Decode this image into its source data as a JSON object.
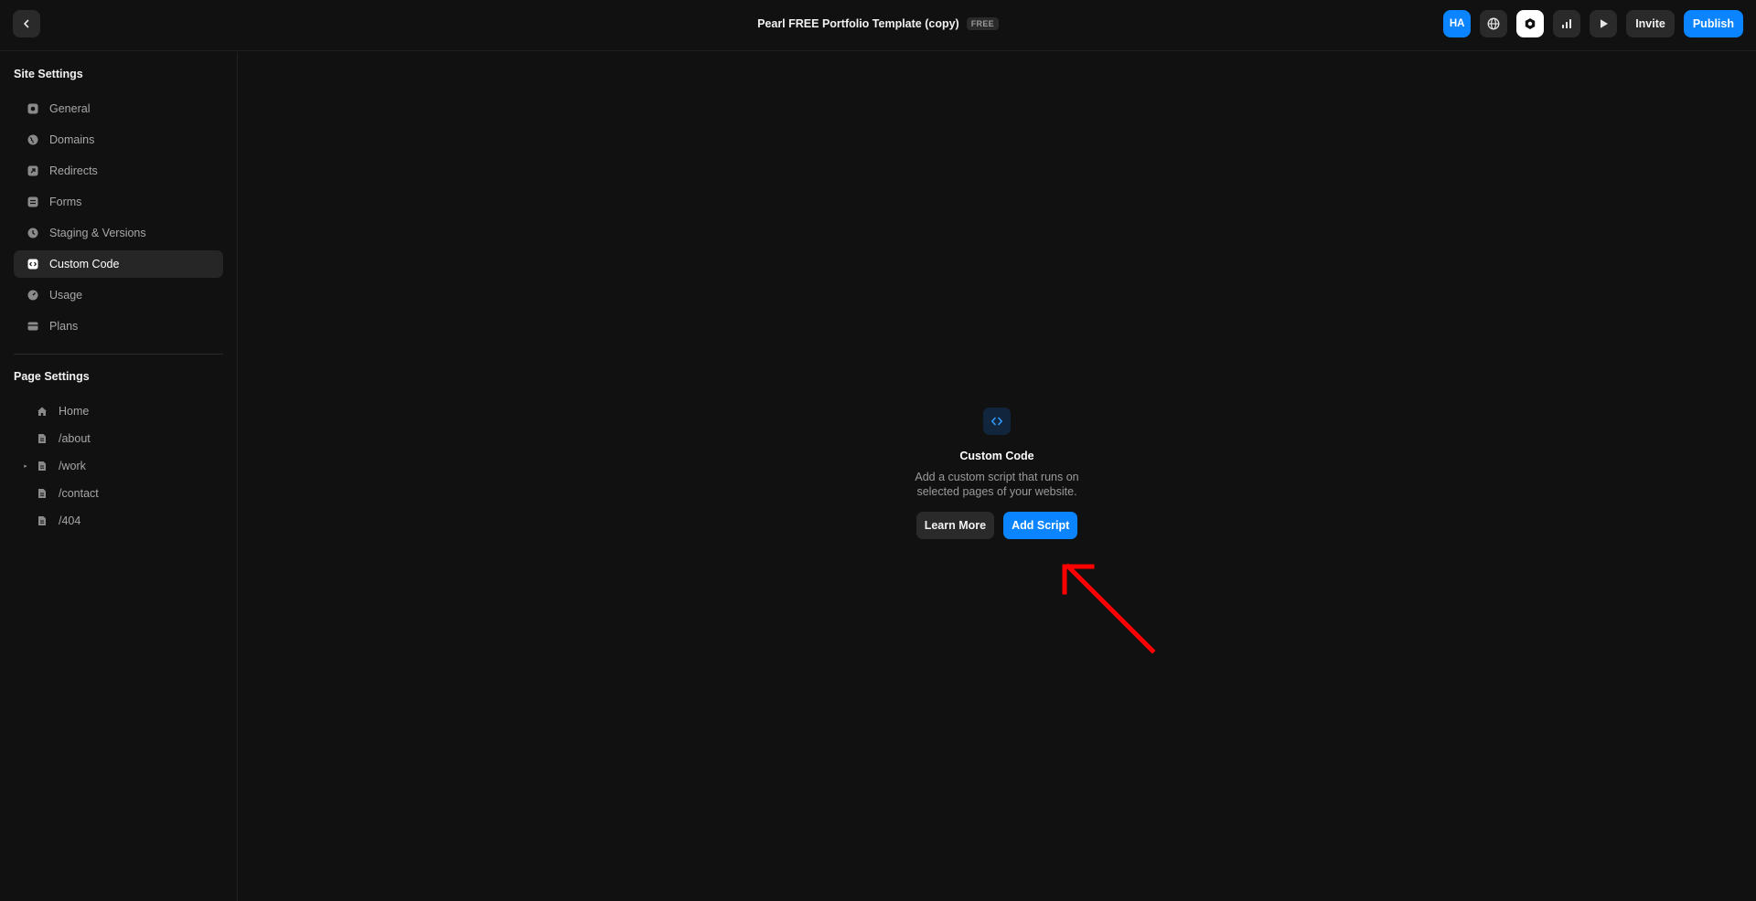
{
  "header": {
    "title": "Pearl FREE Portfolio Template (copy)",
    "plan_badge": "FREE",
    "avatar_initials": "HA",
    "invite_label": "Invite",
    "publish_label": "Publish",
    "icons": [
      "chevron-left-icon",
      "globe-icon",
      "settings-hexagon-icon",
      "bar-chart-icon",
      "play-icon"
    ]
  },
  "sidebar": {
    "site_settings_heading": "Site Settings",
    "items": [
      {
        "label": "General",
        "icon": "general-icon"
      },
      {
        "label": "Domains",
        "icon": "globe-icon"
      },
      {
        "label": "Redirects",
        "icon": "redirect-icon"
      },
      {
        "label": "Forms",
        "icon": "form-icon"
      },
      {
        "label": "Staging & Versions",
        "icon": "clock-icon"
      },
      {
        "label": "Custom Code",
        "icon": "code-icon",
        "active": true
      },
      {
        "label": "Usage",
        "icon": "gauge-icon"
      },
      {
        "label": "Plans",
        "icon": "card-icon"
      }
    ],
    "page_settings_heading": "Page Settings",
    "pages": [
      {
        "label": "Home",
        "icon": "home-icon"
      },
      {
        "label": "/about",
        "icon": "file-icon"
      },
      {
        "label": "/work",
        "icon": "file-icon",
        "expandable": true
      },
      {
        "label": "/contact",
        "icon": "file-icon"
      },
      {
        "label": "/404",
        "icon": "file-icon"
      }
    ]
  },
  "main": {
    "empty_state": {
      "icon": "code-icon",
      "title": "Custom Code",
      "description": "Add a custom script that runs on selected pages of your website.",
      "learn_more_label": "Learn More",
      "add_script_label": "Add Script"
    }
  },
  "colors": {
    "background": "#111111",
    "accent": "#0a84ff",
    "annotation_arrow": "#ff0000"
  }
}
